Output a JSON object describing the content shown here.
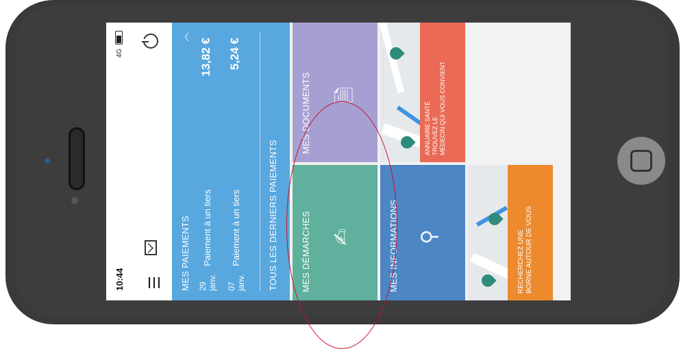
{
  "status_bar": {
    "time": "10:44",
    "network": "4G"
  },
  "payments": {
    "title": "MES PAIEMENTS",
    "items": [
      {
        "day": "29",
        "month": "janv.",
        "label": "Paiement à un tiers",
        "amount": "13,82 €"
      },
      {
        "day": "07",
        "month": "janv.",
        "label": "Paiement à un tiers",
        "amount": "5,24 €"
      }
    ],
    "all_link": "TOUS LES DERNIERS PAIEMENTS"
  },
  "tiles": {
    "demarches": "MES DÉMARCHES",
    "documents": "MES DOCUMENTS",
    "informations": "MES INFORMATIONS",
    "annuaire": [
      "ANNUAIRE SANTÉ",
      "TROUVEZ LE",
      "MÉDECIN QUI VOUS CONVIENT"
    ],
    "borne": [
      "RECHERCHEZ UNE",
      "BORNE AUTOUR DE VOUS"
    ]
  },
  "colors": {
    "payments": "#58a7df",
    "demarches": "#5fb09c",
    "documents": "#a6a0d2",
    "informations": "#4d86c5",
    "annuaire": "#ea6a55",
    "borne": "#ee8a2e"
  }
}
